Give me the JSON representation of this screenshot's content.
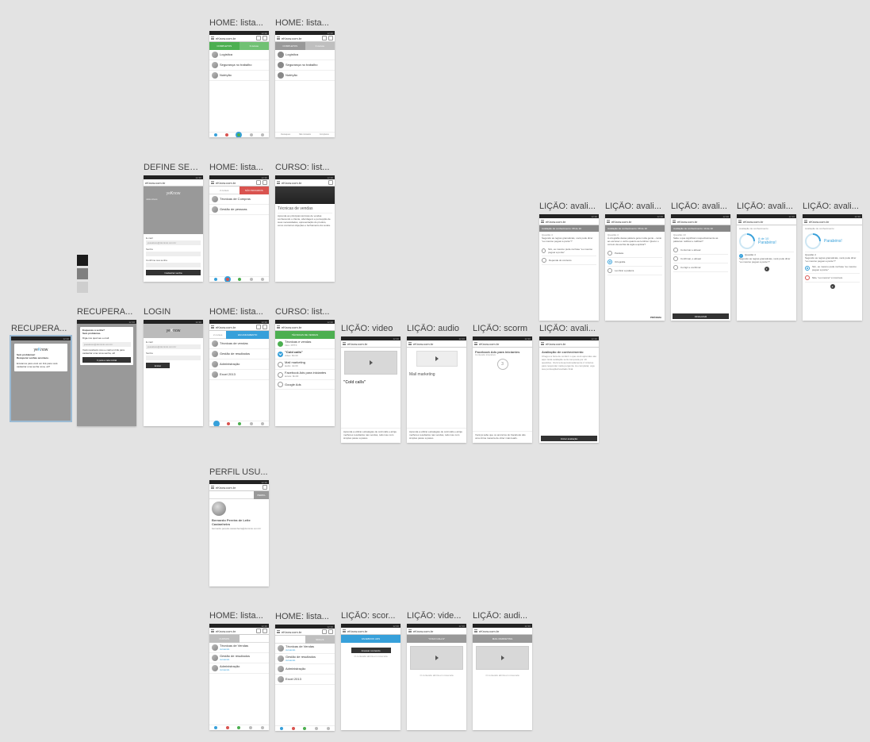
{
  "statusbar": "12:30",
  "logo": "eKnow.com.br",
  "swatches": [
    "#1a1a1a",
    "#7f7f7f",
    "#cecece"
  ],
  "home_completos": {
    "title": "HOME: lista...",
    "tab": "COMPLETOS",
    "sub": "3 cursos",
    "items": [
      "Logística",
      "Segurança no trabalho",
      "Nutrição"
    ]
  },
  "home_completos_b": {
    "title": "HOME: lista..."
  },
  "bottomnav_labels": [
    "Destaques",
    "Não iniciados",
    "Completos"
  ],
  "define_senha": {
    "title": "DEFINE SEN...",
    "user": "João Alves",
    "f1": "E-mail",
    "p1": "joaoalves@dominio.com.br",
    "f2": "Senha",
    "f3": "Confirme sua senha",
    "btn": "Cadastrar senha"
  },
  "home_nao_iniciados": {
    "title": "HOME: lista...",
    "tab": "NÃO INICIADOS",
    "items": [
      "Técnicas de Compras",
      "Gestão de pessoas"
    ]
  },
  "curso_listagem": {
    "title": "CURSO: list...",
    "heading": "Técnicas de vendas",
    "desc": "Aprenda as principais técnicas de vendas conhecendo o cliente, abordagem e percepção de suas necessidades, apresentação do produto, como contornar objeções e fechamento da venda."
  },
  "recupera_1": {
    "title": "RECUPERA...",
    "h": "Sem problemas!\nRecuperar senhas acontece.",
    "body": "Enviamos para você um link para você cadastrar uma senha nova, ok?"
  },
  "recupera_2": {
    "title": "RECUPERA...",
    "h": "Esqueceu a senha?\nSem problemas.",
    "sub": "Diga-nos qual seu e-mail:",
    "p": "joaoalves@dominio.com.br",
    "body": "Você receberá novo e-mail um link para cadastrar uma nova senha, ok!",
    "btn": "Ir para a tela inicial"
  },
  "login": {
    "title": "LOGIN",
    "f1": "E-mail",
    "p1": "joaoalves@dominio.com.br",
    "f2": "Senha",
    "btn": "Entrar"
  },
  "home_andamento": {
    "title": "HOME: lista...",
    "tab": "EM ANDAMENTO",
    "items": [
      "Técnicas de vendas",
      "Gestão de resultados",
      "Administração",
      "Excel 2013"
    ]
  },
  "curso_licoes": {
    "title": "CURSO: list...",
    "header": "TÉCNICAS DE VENDAS",
    "items": [
      [
        "Técnicas e vendas",
        "Intro: PPTX"
      ],
      [
        "\"Cold calls\"",
        "vídeo: 8m30"
      ],
      [
        "Mail marketing",
        "áudio: 4m30"
      ],
      [
        "Facebook Ads para iniciantes",
        "leitura: 8m30"
      ],
      [
        "Google Ads",
        ""
      ]
    ]
  },
  "licao_video": {
    "title": "LIÇÃO: video",
    "h": "\"Cold calls\"",
    "body": "Aprenda a utilizar estratégias de cold calls e atinja melhores resultados nas vendas, tudo isso com simples passo a passo."
  },
  "licao_audio": {
    "title": "LIÇÃO: audio",
    "h": "Mail marketing"
  },
  "licao_scorm": {
    "title": "LIÇÃO: scorm",
    "h": "Facebook Ads para iniciantes",
    "sub": "Conteúdo interativo",
    "n": "3",
    "body": "Você já sabe que os anúncios do Facebook são uma ótima maneira de obter mais leads."
  },
  "licao_avali_intro": {
    "title": "LIÇÃO: avali...",
    "h": "Avaliação de conhecimento",
    "body": "Chegou a hora de conferir o que você aprendeu até aqui. Esta avaliação será composta por 10 questões. Você terá aproximadamente 2 minutos para responder cada pergunta. Ao completar, veja sua pontuação/resultado final.",
    "btn": "Iniciar avaliação"
  },
  "aval_q1": {
    "title": "LIÇÃO: avali...",
    "hdr": "Avaliação de conhecimento: 08 de 10",
    "q": "Questão 4",
    "prompt": "Segundo as regras gramaticais, você pode dizer \"eu mesmo peguei a ponte\"?",
    "opts": [
      "Sim, eu mesmo pude na frase \"eu mesmo peguei a ponte\"",
      "Depende do contexto"
    ]
  },
  "aval_q2": {
    "title": "LIÇÃO: avali...",
    "prompt": "A ortografia dessa palavra gera muita gente – tanto ao escrever o verbo quanto ao lembrar. Qual é o correto da escrita da sigla a aplicar?",
    "opts": [
      "Paralela",
      "Ortografia",
      "Lembrar a palavra"
    ],
    "btn": "PRÓXIMA"
  },
  "aval_q3": {
    "title": "LIÇÃO: avali...",
    "hdr": "Avaliação de conhecimento: 10 de 10",
    "q": "Questão 10",
    "prompt": "Sabe o que significam respectivamente as palavras: retificar e ratificar?",
    "opts": [
      "Contornar e alinear",
      "Confirmar, e alinear",
      "Corrigir e confirmar"
    ],
    "btn": "FINALIZAR"
  },
  "aval_r1": {
    "title": "LIÇÃO: avali...",
    "h": "Avaliação de conhecimento",
    "score": "8 de 10",
    "msg": "Parabéns!",
    "q": "Questão 4",
    "prompt": "Segundo as regras gramaticais, você pode dizer \"eu mesmo peguei a ponte\"?"
  },
  "aval_r2": {
    "title": "LIÇÃO: avali...",
    "opts": [
      "Sim, eu mesmo pude na frase \"eu mesmo peguei a ponte\"",
      "Não, \"eu mesmo\" é incorreto"
    ]
  },
  "perfil": {
    "title": "PERFIL USU...",
    "tab": "PERFIL",
    "name": "Bernardo Pereira de Leite Castanheira",
    "email": "bernardo.pereira.castanheira@dominio.com.br"
  },
  "home_cursos": {
    "title": "HOME: lista...",
    "tab": "CURSOS",
    "items": [
      [
        "Técnicas de Vendas",
        "cursando"
      ],
      [
        "Gestão de resultados",
        "cursando"
      ],
      [
        "Administração",
        "cursando"
      ]
    ]
  },
  "home_skills": {
    "title": "HOME: lista...",
    "tab": "SKILLS",
    "items": [
      [
        "Técnicas de Vendas",
        "cursando"
      ],
      [
        "Gestão de resultados",
        "cursando"
      ],
      [
        "Administração",
        ""
      ],
      [
        "Excel 2013",
        ""
      ]
    ]
  },
  "licao_scorm_open": {
    "title": "LIÇÃO: scor...",
    "hdr": "FACEBOOK ADS",
    "btn": "Acessar conteúdo",
    "note": "O conteúdo abrirá em nova tela"
  },
  "licao_video_open": {
    "title": "LIÇÃO: vide...",
    "hdr": "\"COLD CALLS\"",
    "note": "O conteúdo abrirá em nova tela"
  },
  "licao_audio_open": {
    "title": "LIÇÃO: audi...",
    "hdr": "MAIL MARKETING"
  }
}
